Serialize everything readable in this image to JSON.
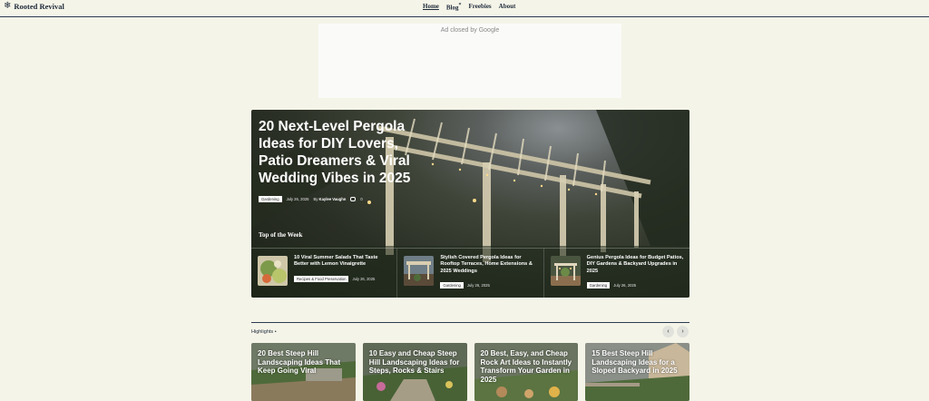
{
  "site": {
    "title": "Rooted Revival",
    "logo_icon": "snowflake-icon"
  },
  "nav": {
    "items": [
      "Home",
      "Blog",
      "Freebies",
      "About"
    ],
    "active": "Home",
    "blog_marker": "*"
  },
  "ad": {
    "text": "Ad closed by Google"
  },
  "hero": {
    "title": "20 Next-Level Pergola Ideas for DIY Lovers, Patio Dreamers & Viral Wedding Vibes in 2025",
    "category": "Gardening",
    "date": "July 26, 2025",
    "author_prefix": "By",
    "author": "Kaylee Vaughn",
    "comments": "0"
  },
  "top_of_week": {
    "label": "Top of the Week",
    "items": [
      {
        "title": "10 Viral Summer Salads That Taste Better with Lemon Vinaigrette",
        "category": "Recipes & Food Preservation",
        "date": "July 26, 2025"
      },
      {
        "title": "Stylish Covered Pergola Ideas for Rooftop Terraces, Home Extensions & 2025 Weddings",
        "category": "Gardening",
        "date": "July 26, 2025"
      },
      {
        "title": "Genius Pergola Ideas for Budget Patios, DIY Gardens & Backyard Upgrades in 2025",
        "category": "Gardening",
        "date": "July 26, 2025"
      }
    ]
  },
  "highlights": {
    "label": "Highlights",
    "label_marker": "•",
    "prev": "‹",
    "next": "›",
    "items": [
      {
        "title": "20 Best Steep Hill Landscaping Ideas That Keep Going Viral"
      },
      {
        "title": "10 Easy and Cheap Steep Hill Landscaping Ideas for Steps, Rocks & Stairs"
      },
      {
        "title": "20 Best, Easy, and Cheap Rock Art Ideas to Instantly Transform Your Garden in 2025"
      },
      {
        "title": "15 Best Steep Hill Landscaping Ideas for a Sloped Backyard in 2025"
      }
    ]
  }
}
